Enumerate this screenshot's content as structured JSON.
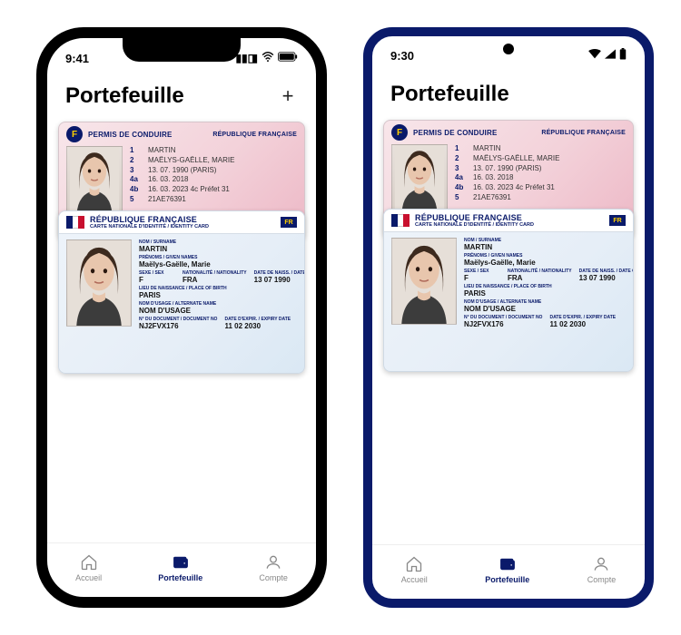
{
  "iphone": {
    "time": "9:41",
    "title": "Portefeuille",
    "cards": {
      "permis": {
        "header_title": "PERMIS DE CONDUIRE",
        "country": "RÉPUBLIQUE FRANÇAISE",
        "flag_letter": "F",
        "rows": [
          {
            "k": "1",
            "v": "MARTIN"
          },
          {
            "k": "2",
            "v": "MAËLYS-GAËLLE, MARIE"
          },
          {
            "k": "3",
            "v": "13. 07. 1990 (PARIS)"
          },
          {
            "k": "4a",
            "v": "16. 03. 2018"
          },
          {
            "k": "4b",
            "v": "16. 03. 2023   4c  Préfet 31"
          },
          {
            "k": "5",
            "v": "21AE76391"
          }
        ]
      },
      "cni": {
        "header_title": "RÉPUBLIQUE FRANÇAISE",
        "subtitle": "CARTE NATIONALE D'IDENTITÉ / IDENTITY CARD",
        "eu_label": "FR",
        "fields": {
          "nom_label": "NOM / Surname",
          "nom": "MARTIN",
          "prenom_label": "Prénoms / Given names",
          "prenom": "Maëlys-Gaëlle, Marie",
          "sexe_label": "SEXE / Sex",
          "sexe": "F",
          "nat_label": "NATIONALITÉ / Nationality",
          "nat": "FRA",
          "dob_label": "DATE DE NAISS. / Date of birth",
          "dob": "13 07 1990",
          "pob_label": "Lieu de naissance / Place of birth",
          "pob": "PARIS",
          "alt_label": "Nom d'usage / Alternate name",
          "alt": "NOM D'USAGE",
          "docnum_label": "N° DU DOCUMENT / Document No",
          "docnum": "NJ2FVX176",
          "exp_label": "DATE D'EXPIR. / Expiry date",
          "exp": "11 02 2030"
        }
      }
    },
    "tabs": [
      {
        "label": "Accueil",
        "active": false
      },
      {
        "label": "Portefeuille",
        "active": true
      },
      {
        "label": "Compte",
        "active": false
      }
    ]
  },
  "android": {
    "time": "9:30",
    "title": "Portefeuille",
    "tabs": [
      {
        "label": "Accueil",
        "active": false
      },
      {
        "label": "Portefeuille",
        "active": true
      },
      {
        "label": "Compte",
        "active": false
      }
    ]
  }
}
